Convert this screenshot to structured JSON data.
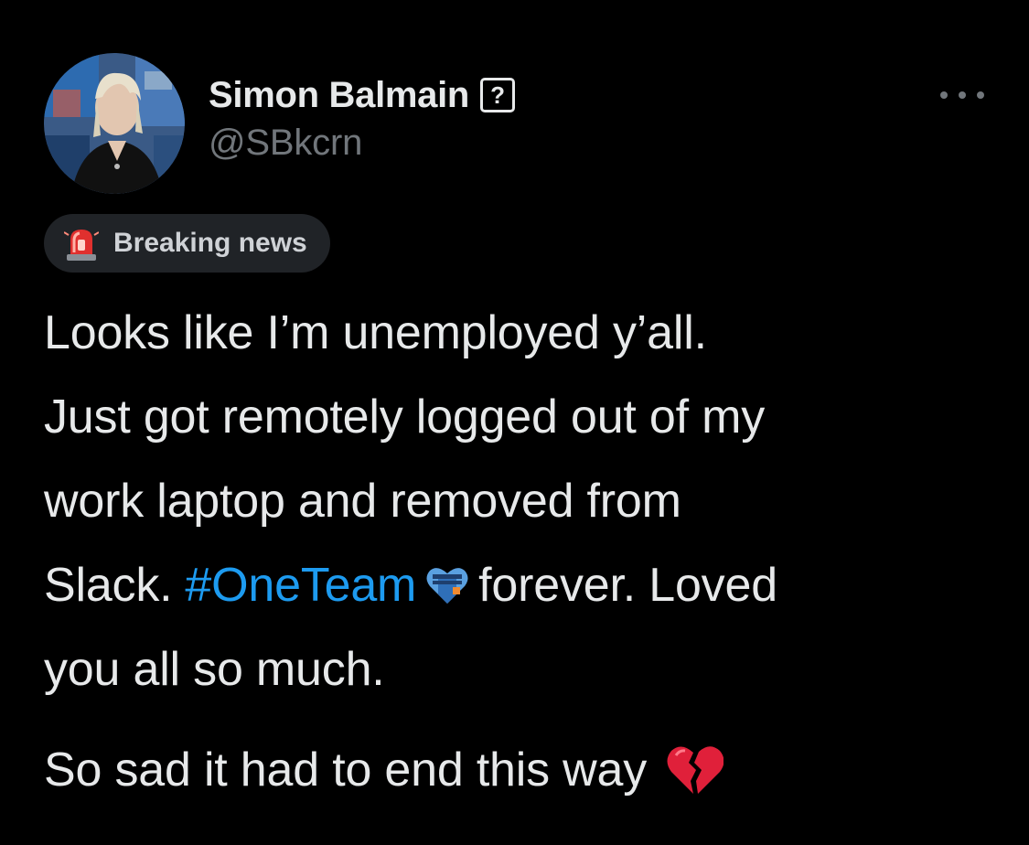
{
  "tweet": {
    "author": {
      "display_name": "Simon Balmain",
      "badge": "?",
      "handle": "@SBkcrn"
    },
    "menu_icon": "more-horizontal-icon",
    "label_pill": {
      "icon": "police-light-icon",
      "text": "Breaking news"
    },
    "body": {
      "line1": "Looks like I’m unemployed y’all.",
      "line2": "Just got remotely logged out of my",
      "line3": "work laptop and removed from",
      "line4_before": "Slack.",
      "hashtag": "#OneTeam",
      "hashflag_icon": "oneteam-heart-hashflag-icon",
      "line4_after": "forever. Loved",
      "line5": "you all so much.",
      "para2": "So sad it had to end this way",
      "para2_emoji": "broken-heart-icon"
    },
    "colors": {
      "background": "#000000",
      "text": "#e7e9ea",
      "secondary": "#71767b",
      "hashtag": "#1d9bf0",
      "pill_bg": "#202327"
    }
  }
}
